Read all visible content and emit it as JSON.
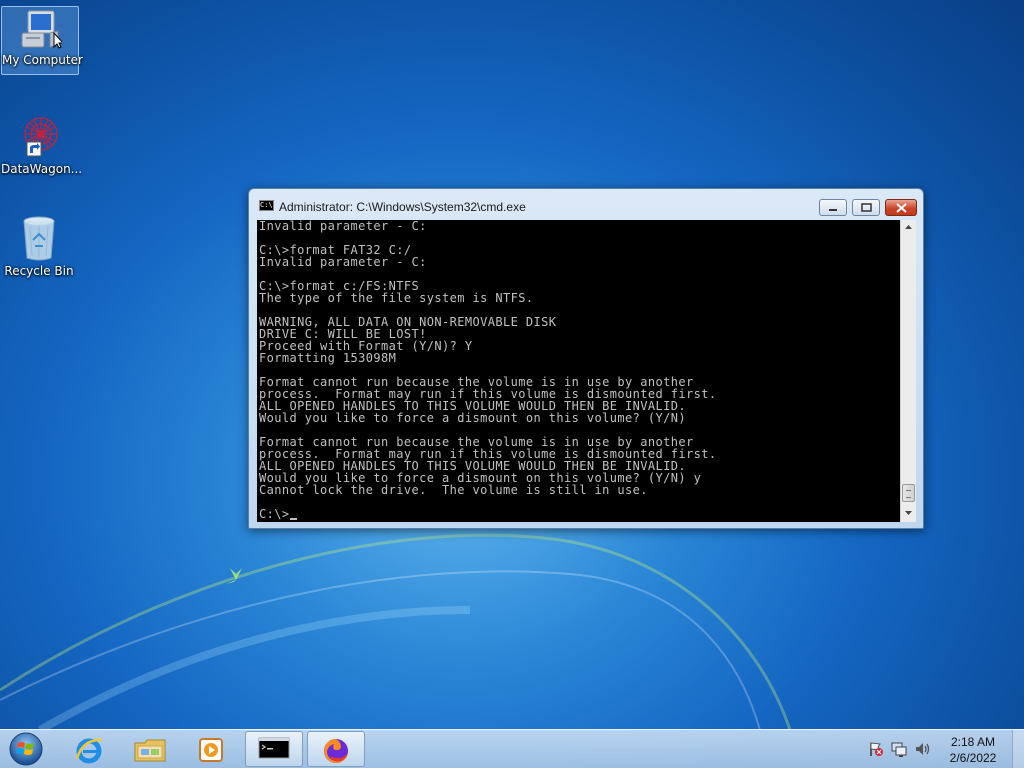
{
  "desktop": {
    "icons": [
      {
        "label": "My Computer"
      },
      {
        "label": "DataWagon..."
      },
      {
        "label": "Recycle Bin"
      }
    ]
  },
  "window": {
    "title": "Administrator: C:\\Windows\\System32\\cmd.exe",
    "title_icon_text": "C:\\"
  },
  "console": {
    "lines": [
      "Invalid parameter - C:",
      "",
      "C:\\>format FAT32 C:/",
      "Invalid parameter - C:",
      "",
      "C:\\>format c:/FS:NTFS",
      "The type of the file system is NTFS.",
      "",
      "WARNING, ALL DATA ON NON-REMOVABLE DISK",
      "DRIVE C: WILL BE LOST!",
      "Proceed with Format (Y/N)? Y",
      "Formatting 153098M",
      "",
      "Format cannot run because the volume is in use by another",
      "process.  Format may run if this volume is dismounted first.",
      "ALL OPENED HANDLES TO THIS VOLUME WOULD THEN BE INVALID.",
      "Would you like to force a dismount on this volume? (Y/N)",
      "",
      "Format cannot run because the volume is in use by another",
      "process.  Format may run if this volume is dismounted first.",
      "ALL OPENED HANDLES TO THIS VOLUME WOULD THEN BE INVALID.",
      "Would you like to force a dismount on this volume? (Y/N) y",
      "Cannot lock the drive.  The volume is still in use.",
      ""
    ],
    "prompt": "C:\\>"
  },
  "taskbar": {
    "items": [
      {
        "icon": "internet-explorer-icon"
      },
      {
        "icon": "file-explorer-icon"
      },
      {
        "icon": "media-player-icon"
      },
      {
        "icon": "cmd-icon"
      },
      {
        "icon": "firefox-icon"
      }
    ],
    "clock": {
      "time": "2:18 AM",
      "date": "2/6/2022"
    }
  },
  "colors": {
    "console_bg": "#000000",
    "console_fg": "#c0c0c0",
    "close_button": "#c9472b"
  }
}
